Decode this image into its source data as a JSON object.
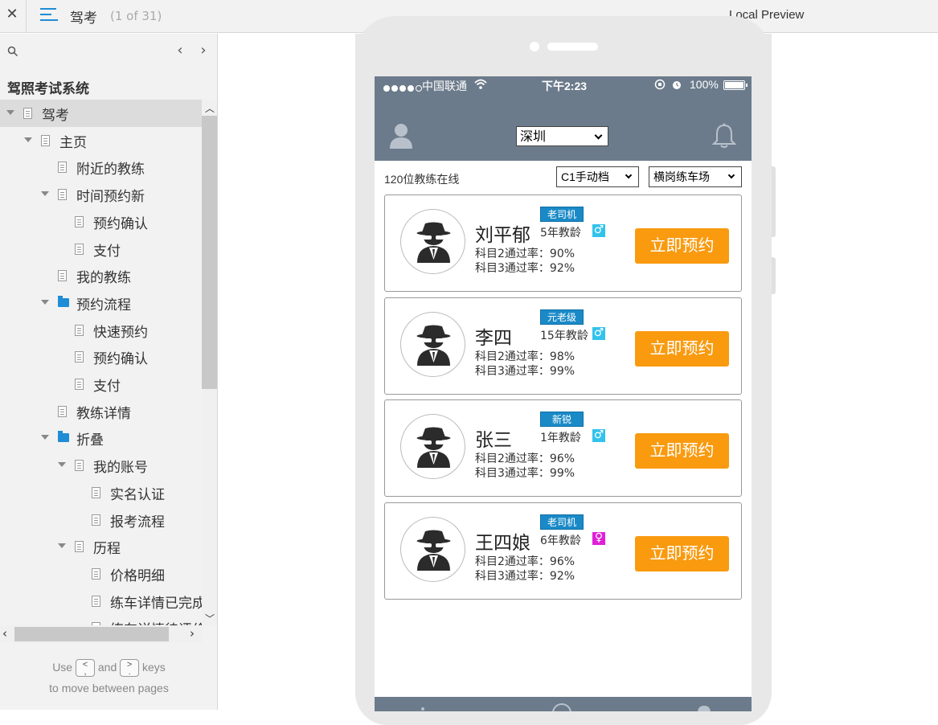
{
  "topbar": {
    "close_glyph": "✕",
    "page_title": "驾考",
    "page_count": "(1 of 31)",
    "preview_label": "Local Preview"
  },
  "sidebar": {
    "project_name": "驾照考试系统",
    "nav_prev": "‹",
    "nav_next": "›",
    "tree": [
      {
        "label": "驾考",
        "type": "page",
        "depth": 0,
        "expanded": true,
        "selected": true
      },
      {
        "label": "主页",
        "type": "page",
        "depth": 1,
        "expanded": true
      },
      {
        "label": "附近的教练",
        "type": "page",
        "depth": 2
      },
      {
        "label": "时间预约新",
        "type": "page",
        "depth": 2,
        "expanded": true
      },
      {
        "label": "预约确认",
        "type": "page",
        "depth": 3
      },
      {
        "label": "支付",
        "type": "page",
        "depth": 3
      },
      {
        "label": "我的教练",
        "type": "page",
        "depth": 2
      },
      {
        "label": "预约流程",
        "type": "folder",
        "depth": 2,
        "expanded": true
      },
      {
        "label": "快速预约",
        "type": "page",
        "depth": 3
      },
      {
        "label": "预约确认",
        "type": "page",
        "depth": 3
      },
      {
        "label": "支付",
        "type": "page",
        "depth": 3
      },
      {
        "label": "教练详情",
        "type": "page",
        "depth": 2
      },
      {
        "label": "折叠",
        "type": "folder",
        "depth": 2,
        "expanded": true
      },
      {
        "label": "我的账号",
        "type": "page",
        "depth": 3,
        "expanded": true
      },
      {
        "label": "实名认证",
        "type": "page",
        "depth": 4
      },
      {
        "label": "报考流程",
        "type": "page",
        "depth": 4
      },
      {
        "label": "历程",
        "type": "page",
        "depth": 3,
        "expanded": true
      },
      {
        "label": "价格明细",
        "type": "page",
        "depth": 4
      },
      {
        "label": "练车详情已完成",
        "type": "page",
        "depth": 4
      },
      {
        "label": "练车详情待评价",
        "type": "page",
        "depth": 4
      }
    ],
    "hint": {
      "use": "Use",
      "key_prev": "<\n,",
      "and": "and",
      "key_next": ">\n.",
      "keys": "keys",
      "line2": "to move between pages"
    }
  },
  "phone": {
    "status": {
      "carrier": "中国联通",
      "time": "下午2:23",
      "battery": "100%"
    },
    "header": {
      "city": "深圳"
    },
    "online_count": "120位教练在线",
    "filters": {
      "license": "C1手动档",
      "location": "横岗练车场"
    },
    "coaches": [
      {
        "name": "刘平郁",
        "badge": "老司机",
        "years": "5年教龄",
        "gender": "male",
        "gender_glyph": "♂",
        "rate2": "科目2通过率：90%",
        "rate3": "科目3通过率：92%",
        "button": "立即预约"
      },
      {
        "name": "李四",
        "badge": "元老级",
        "years": "15年教龄",
        "gender": "male",
        "gender_glyph": "♂",
        "rate2": "科目2通过率：98%",
        "rate3": "科目3通过率：99%",
        "button": "立即预约"
      },
      {
        "name": "张三",
        "badge": "新锐",
        "years": "1年教龄",
        "gender": "male",
        "gender_glyph": "♂",
        "rate2": "科目2通过率：96%",
        "rate3": "科目3通过率：99%",
        "button": "立即预约"
      },
      {
        "name": "王四娘",
        "badge": "老司机",
        "years": "6年教龄",
        "gender": "female",
        "gender_glyph": "♀",
        "rate2": "科目2通过率：96%",
        "rate3": "科目3通过率：92%",
        "button": "立即预约"
      }
    ]
  },
  "colors": {
    "accent_blue": "#1f8dd6",
    "header_slate": "#6c7b8b",
    "book_orange": "#f99a0f",
    "badge_blue": "#1a8ac7",
    "male_cyan": "#33c2ec",
    "female_magenta": "#e020d8"
  }
}
